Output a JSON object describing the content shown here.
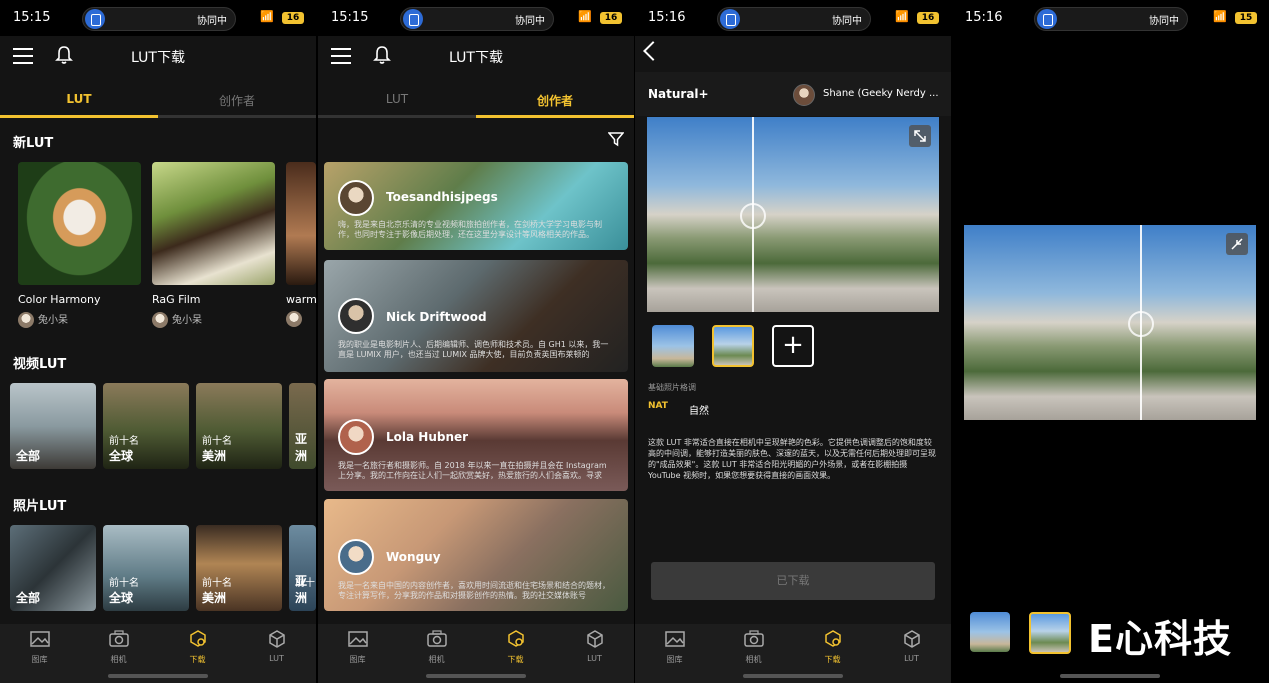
{
  "status": [
    {
      "time": "15:15",
      "sync": "协同中",
      "battery": "16"
    },
    {
      "time": "15:15",
      "sync": "协同中",
      "battery": "16"
    },
    {
      "time": "15:16",
      "sync": "协同中",
      "battery": "16"
    },
    {
      "time": "15:16",
      "sync": "协同中",
      "battery": "15"
    }
  ],
  "header": {
    "title": "LUT下载"
  },
  "tabs": {
    "lut": "LUT",
    "creators": "创作者"
  },
  "screen1": {
    "new_lut_title": "新LUT",
    "new_luts": [
      {
        "name": "Color Harmony",
        "author": "兔小呆"
      },
      {
        "name": "RaG Film",
        "author": "兔小呆"
      },
      {
        "name": "warm",
        "author": ""
      }
    ],
    "video_lut_title": "视频LUT",
    "video_tiles": [
      {
        "line1": "",
        "line2": "全部"
      },
      {
        "line1": "前十名",
        "line2": "全球"
      },
      {
        "line1": "前十名",
        "line2": "美洲"
      },
      {
        "line1": "",
        "line2": "亚洲"
      }
    ],
    "photo_lut_title": "照片LUT",
    "photo_tiles": [
      {
        "line1": "",
        "line2": "全部"
      },
      {
        "line1": "前十名",
        "line2": "全球"
      },
      {
        "line1": "前十名",
        "line2": "美洲"
      },
      {
        "line1": "前十",
        "line2": "亚洲"
      }
    ]
  },
  "screen2": {
    "creators": [
      {
        "name": "Toesandhisjpegs",
        "desc": "嗨，我是来自北京乐清的专业视频和旅拍创作者，在剑桥大学学习电影与制作，也同时专注于影像后期处理，还在这里分享设计等风格相关的作品。"
      },
      {
        "name": "Nick Driftwood",
        "desc": "我的职业是电影制片人、后期编辑师、调色师和技术员。自 GH1 以来，我一直是 LUMIX 用户，也还当过 LUMIX 品牌大使，目前负责英国布莱顿的 Driftwood..."
      },
      {
        "name": "Lola Hubner",
        "desc": "我是一名旅行者和摄影师。自 2018 年以来一直在拍摄并且会在 Instagram 上分享。我的工作向在让人们一起欣赏美好，热爱旅行的人们会喜欢。寻求灵..."
      },
      {
        "name": "Wonguy",
        "desc": "我是一名来自中国的内容创作者，喜欢用时间流逝和住宅场景和结合的题材，专注计算写作，分享我的作品和对摄影创作的热情。我的社交媒体账号Wonguy。"
      }
    ]
  },
  "screen3": {
    "title": "Natural+",
    "author": "Shane (Geeky Nerdy ...",
    "base_label": "基础照片格调",
    "style_badge": "NAT",
    "style_name": "自然",
    "description": "这款 LUT 非常适合直接在相机中呈现鲜艳的色彩。它提供色调调整后的饱和度较高的中间调，能够打造美丽的肤色、深邃的蓝天，以及无需任何后期处理即可呈现的\"成品效果\"。这款 LUT 非常适合阳光明媚的户外场景，或者在影棚拍摄 YouTube 视频时，如果您想要获得直接的画面效果。",
    "add_label": "+",
    "downloaded_label": "已下载"
  },
  "screen4": {
    "watermark": "E心科技"
  },
  "nav": [
    {
      "label": "图库",
      "icon": "gallery-icon"
    },
    {
      "label": "相机",
      "icon": "camera-icon"
    },
    {
      "label": "下载",
      "icon": "download-icon"
    },
    {
      "label": "LUT",
      "icon": "cube-icon"
    }
  ],
  "colors": {
    "accent": "#f2c230",
    "background": "#141414",
    "nav": "#1d1d1d"
  }
}
